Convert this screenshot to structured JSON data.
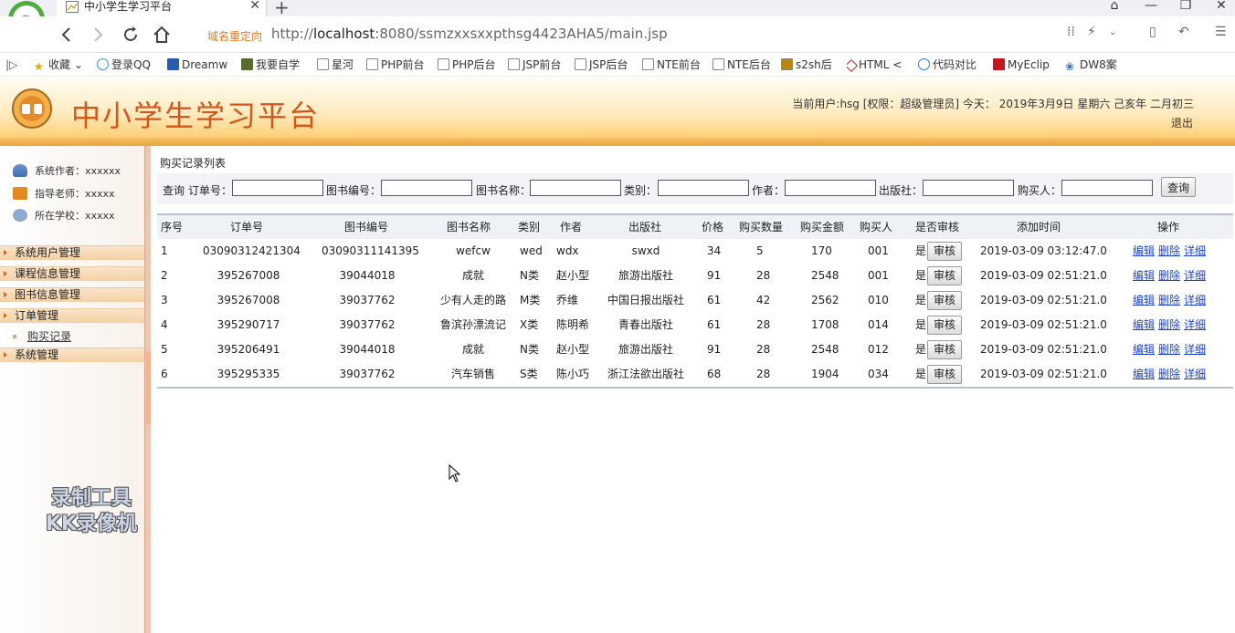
{
  "browser": {
    "tab_title": "中小学生学习平台",
    "redirect_label": "域名重定向",
    "url_prefix": "http://",
    "url_host": "localhost",
    "url_rest": ":8080/ssmzxxsxxpthsg4423AHA5/main.jsp",
    "bookmarks": [
      "收藏",
      "登录QQ",
      "Dreamw",
      "我要自学",
      "星河",
      "PHP前台",
      "PHP后台",
      "JSP前台",
      "JSP后台",
      "NTE前台",
      "NTE后台",
      "s2sh后",
      "HTML",
      "代码对比",
      "MyEclip",
      "DW8案"
    ]
  },
  "header": {
    "site_title": "中小学生学习平台",
    "user_info": "当前用户:hsg [权限：超级管理员] 今天： 2019年3月9日 星期六 己亥年 二月初三",
    "logout": "退出"
  },
  "sidebar": {
    "info": [
      "系统作者：xxxxxx",
      "指导老师：xxxxx",
      "所在学校：xxxxx"
    ],
    "menus": [
      "系统用户管理",
      "课程信息管理",
      "图书信息管理",
      "订单管理",
      "系统管理"
    ],
    "submenu_item": "购买记录"
  },
  "main": {
    "list_title": "购买记录列表",
    "search": {
      "query_label": "查询",
      "fields": [
        "订单号：",
        "图书编号：",
        "图书名称：",
        "类别：",
        "作者：",
        "出版社：",
        "购买人："
      ],
      "button": "查询"
    },
    "columns": [
      "序号",
      "订单号",
      "图书编号",
      "图书名称",
      "类别",
      "作者",
      "出版社",
      "价格",
      "购买数量",
      "购买金额",
      "购买人",
      "是否审核",
      "添加时间",
      "操作"
    ],
    "audit_button": "审核",
    "actions": [
      "编辑",
      "删除",
      "详细"
    ],
    "rows": [
      {
        "no": "1",
        "order": "03090312421304",
        "book_no": "03090311141395",
        "book_name": "wefcw",
        "cat": "wed",
        "author": "wdx",
        "publisher": "swxd",
        "price": "34",
        "qty": "5",
        "amount": "170",
        "buyer": "001",
        "audited": "是",
        "time": "2019-03-09 03:12:47.0"
      },
      {
        "no": "2",
        "order": "395267008",
        "book_no": "39044018",
        "book_name": "成就",
        "cat": "N类",
        "author": "赵小型",
        "publisher": "旅游出版社",
        "price": "91",
        "qty": "28",
        "amount": "2548",
        "buyer": "001",
        "audited": "是",
        "time": "2019-03-09 02:51:21.0"
      },
      {
        "no": "3",
        "order": "395267008",
        "book_no": "39037762",
        "book_name": "少有人走的路",
        "cat": "M类",
        "author": "乔维",
        "publisher": "中国日报出版社",
        "price": "61",
        "qty": "42",
        "amount": "2562",
        "buyer": "010",
        "audited": "是",
        "time": "2019-03-09 02:51:21.0"
      },
      {
        "no": "4",
        "order": "395290717",
        "book_no": "39037762",
        "book_name": "鲁滨孙漂流记",
        "cat": "X类",
        "author": "陈明希",
        "publisher": "青春出版社",
        "price": "61",
        "qty": "28",
        "amount": "1708",
        "buyer": "014",
        "audited": "是",
        "time": "2019-03-09 02:51:21.0"
      },
      {
        "no": "5",
        "order": "395206491",
        "book_no": "39044018",
        "book_name": "成就",
        "cat": "N类",
        "author": "赵小型",
        "publisher": "旅游出版社",
        "price": "91",
        "qty": "28",
        "amount": "2548",
        "buyer": "012",
        "audited": "是",
        "time": "2019-03-09 02:51:21.0"
      },
      {
        "no": "6",
        "order": "395295335",
        "book_no": "39037762",
        "book_name": "汽车销售",
        "cat": "S类",
        "author": "陈小巧",
        "publisher": "浙江法欲出版社",
        "price": "68",
        "qty": "28",
        "amount": "1904",
        "buyer": "034",
        "audited": "是",
        "time": "2019-03-09 02:51:21.0"
      }
    ]
  },
  "watermark": {
    "line1": "录制工具",
    "line2": "KK录像机"
  },
  "colors": {
    "accent": "#d5561a",
    "link": "#1d43d6",
    "header_orange": "#ffc45a"
  }
}
